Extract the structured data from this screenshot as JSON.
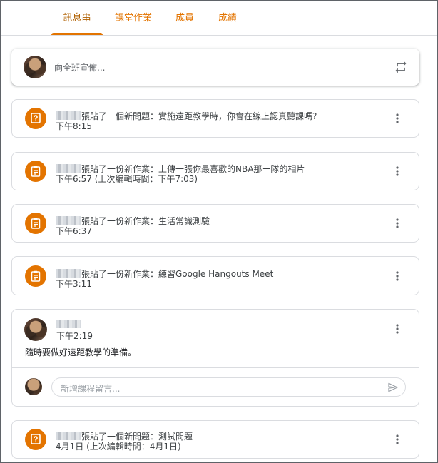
{
  "tabs": [
    {
      "label": "訊息串"
    },
    {
      "label": "課堂作業"
    },
    {
      "label": "成員"
    },
    {
      "label": "成績"
    }
  ],
  "share": {
    "placeholder": "向全班宣佈..."
  },
  "posts": [
    {
      "icon": "question-icon",
      "text": "張貼了一個新問題：實施遠距教學時，你會在線上認真聽課嗎?",
      "time": "下午8:15"
    },
    {
      "icon": "assignment-icon",
      "text": "張貼了一份新作業：上傳一張你最喜歡的NBA那一隊的相片",
      "time": "下午6:57 (上次編輯時間：下午7:03)"
    },
    {
      "icon": "assignment-icon",
      "text": "張貼了一份新作業：生活常識測驗",
      "time": "下午6:37"
    },
    {
      "icon": "assignment-icon",
      "text": "張貼了一份新作業：練習Google Hangouts Meet",
      "time": "下午3:11"
    }
  ],
  "announcement": {
    "time": "下午2:19",
    "body": "隨時要做好遠距教學的準備。",
    "comment_placeholder": "新增課程留言..."
  },
  "last_post": {
    "icon": "question-icon",
    "text": "張貼了一個新問題：測試問題",
    "time": "4月1日 (上次編輯時間：4月1日)"
  },
  "colors": {
    "accent": "#e37400",
    "border": "#dadce0",
    "text": "#3c4043"
  }
}
